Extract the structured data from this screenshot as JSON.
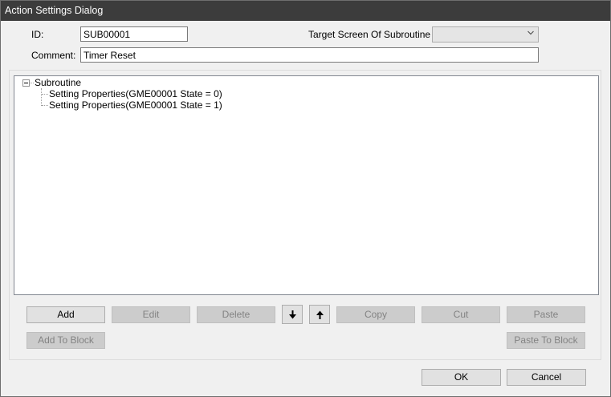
{
  "window": {
    "title": "Action Settings Dialog"
  },
  "form": {
    "id_label": "ID:",
    "id_value": "SUB00001",
    "target_label": "Target Screen Of Subroutine",
    "target_value": "",
    "comment_label": "Comment:",
    "comment_value": "Timer Reset"
  },
  "tree": {
    "root": "Subroutine",
    "children": [
      "Setting Properties(GME00001 State = 0)",
      "Setting Properties(GME00001 State = 1)"
    ]
  },
  "buttons": {
    "add": "Add",
    "edit": "Edit",
    "delete": "Delete",
    "copy": "Copy",
    "cut": "Cut",
    "paste": "Paste",
    "add_to_block": "Add To Block",
    "paste_to_block": "Paste To Block",
    "ok": "OK",
    "cancel": "Cancel"
  },
  "icons": {
    "move_down": "arrow-down-icon",
    "move_up": "arrow-up-icon",
    "dropdown": "chevron-down-icon",
    "expander": "minus-box-icon"
  }
}
